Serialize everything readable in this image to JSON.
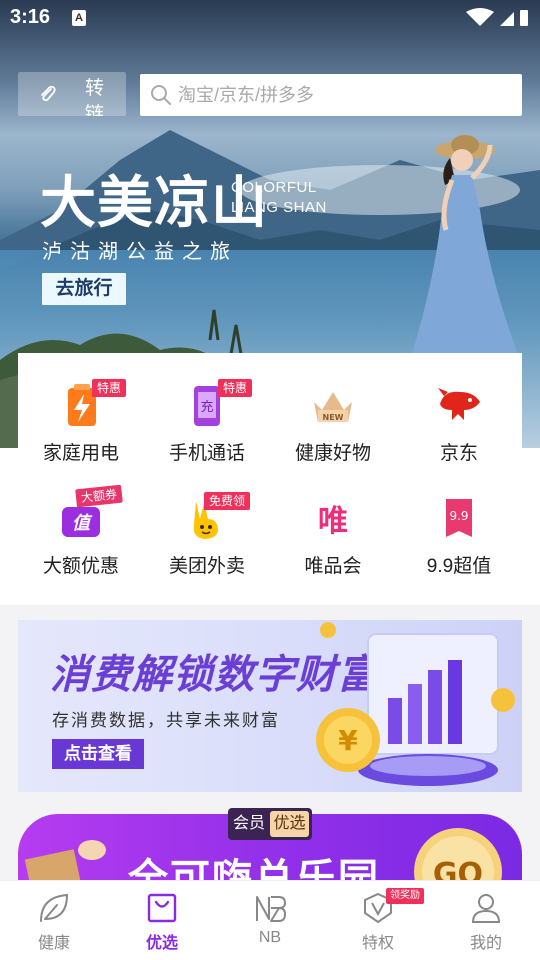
{
  "status_bar": {
    "time": "3:16",
    "notification_letter": "A"
  },
  "header": {
    "convert_label": "转链",
    "search_placeholder": "淘宝/京东/拼多多"
  },
  "hero": {
    "title": "大美凉山",
    "title_en_line1": "COLORFUL",
    "title_en_line2": "LIANG SHAN",
    "subtitle": "泸沽湖公益之旅",
    "cta": "去旅行"
  },
  "categories": [
    {
      "label": "家庭用电",
      "icon": "lightning-battery-icon",
      "badge": "特惠"
    },
    {
      "label": "手机通话",
      "icon": "phone-charge-icon",
      "badge": "特惠",
      "icon_text": "充"
    },
    {
      "label": "健康好物",
      "icon": "crown-new-icon",
      "badge": "",
      "icon_text": "NEW"
    },
    {
      "label": "京东",
      "icon": "jd-dog-icon",
      "badge": ""
    },
    {
      "label": "大额优惠",
      "icon": "coupon-value-icon",
      "badge": "大额券",
      "icon_text": "值"
    },
    {
      "label": "美团外卖",
      "icon": "meituan-kangaroo-icon",
      "badge": "免费领"
    },
    {
      "label": "唯品会",
      "icon": "vip-icon",
      "badge": "",
      "icon_text": "唯"
    },
    {
      "label": "9.9超值",
      "icon": "price-tag-icon",
      "badge": "",
      "icon_text": "9.9"
    }
  ],
  "banner": {
    "title": "消费解锁数字财富",
    "subtitle": "存消费数据，共享未来财富",
    "cta": "点击查看",
    "coin_symbol": "¥"
  },
  "banner2": {
    "tag_left": "会员",
    "tag_right": "优选",
    "title": "全可嗨总乐园",
    "go": "GO"
  },
  "bottom_nav": [
    {
      "label": "健康",
      "icon": "leaf-icon",
      "active": false
    },
    {
      "label": "优选",
      "icon": "shopping-bag-icon",
      "active": true
    },
    {
      "label": "NB",
      "icon": "nb-logo-icon",
      "active": false
    },
    {
      "label": "特权",
      "icon": "vip-shield-icon",
      "active": false,
      "badge": "领奖励"
    },
    {
      "label": "我的",
      "icon": "person-icon",
      "active": false
    }
  ],
  "colors": {
    "accent": "#8a2be2",
    "badge": "#f0305a",
    "banner_purple": "#6938d4"
  }
}
